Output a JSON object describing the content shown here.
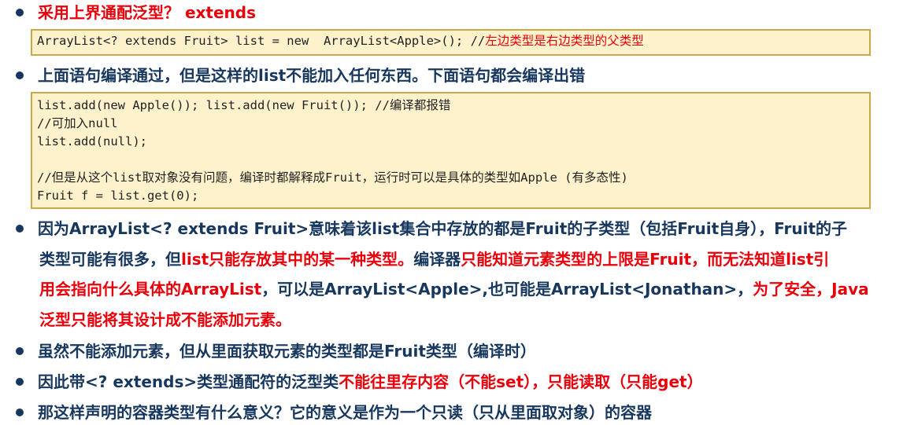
{
  "bullet1": {
    "text": "采用上界通配泛型？",
    "keyword": " extends"
  },
  "code1": {
    "code": "ArrayList<? extends Fruit> list = new  ArrayList<Apple>(); //",
    "comment": "左边类型是右边类型的父类型"
  },
  "bullet2": {
    "text": "上面语句编译通过，但是这样的list不能加入任何东西。下面语句都会编译出错"
  },
  "code2": {
    "line1": "list.add(new Apple()); list.add(new Fruit()); //编译都报错",
    "line2": "//可加入null",
    "line3": "list.add(null);",
    "line4": "//但是从这个list取对象没有问题，编译时都解释成Fruit，运行时可以是具体的类型如Apple (有多态性)",
    "line5": "Fruit f = list.get(0);"
  },
  "bullet3": {
    "part1": "因为ArrayList<? extends Fruit>意味着该list集合中存放的都是Fruit的子类型（包括Fruit自身），Fruit的子",
    "part2": "类型可能有很多，但",
    "part3_red": "list只能存放其中的某一种类型。",
    "part4": "编译器",
    "part5_red": "只能知道元素类型的上限是Fruit，而无法知道list引",
    "part6_red": "用会指向什么具体的ArrayList",
    "part7": "，可以是ArrayList<Apple>,也可能是ArrayList<Jonathan>，",
    "part8_red": "为了安全，Java",
    "part9_red": "泛型只能将其设计成不能添加元素。"
  },
  "bullet4": {
    "text": "虽然不能添加元素，但从里面获取元素的类型都是Fruit类型（编译时）"
  },
  "bullet5": {
    "part1": "因此带<? extends>类型通配符的泛型类",
    "part2_red": "不能往里存内容（不能set），只能读取（只能get）"
  },
  "bullet6": {
    "text": "那这样声明的容器类型有什么意义？它的意义是作为一个只读（只从里面取对象）的容器"
  },
  "colors": {
    "heading": "#17375E",
    "emphasis": "#E8000B",
    "code_bg": "#FEF2CC",
    "code_border": "#C9A94A"
  }
}
